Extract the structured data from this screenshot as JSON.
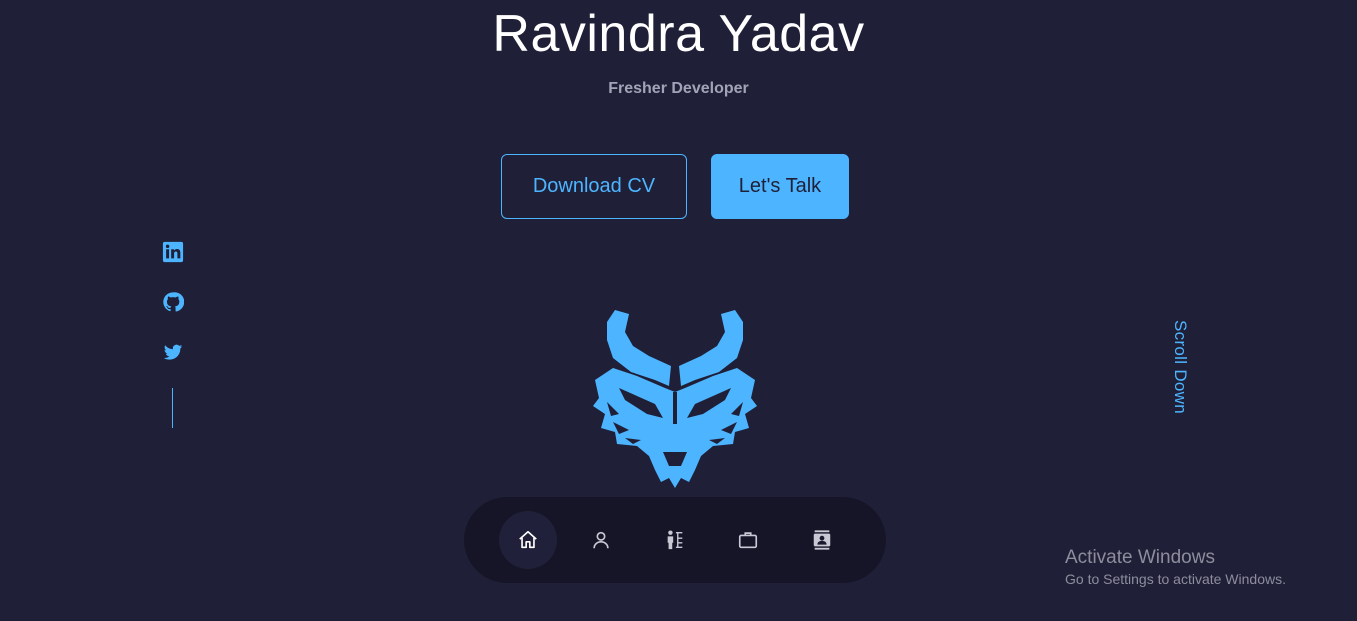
{
  "header": {
    "name": "Ravindra Yadav",
    "role": "Fresher Developer"
  },
  "cta": {
    "download_label": "Download CV",
    "talk_label": "Let's Talk"
  },
  "socials": [
    {
      "name": "linkedin-icon"
    },
    {
      "name": "github-icon"
    },
    {
      "name": "twitter-icon"
    }
  ],
  "logo": {
    "icon": "wolf-head-icon"
  },
  "scroll": {
    "label": "Scroll Down"
  },
  "nav": {
    "items": [
      {
        "icon": "home-icon",
        "active": true
      },
      {
        "icon": "user-icon",
        "active": false
      },
      {
        "icon": "skills-icon",
        "active": false
      },
      {
        "icon": "briefcase-icon",
        "active": false
      },
      {
        "icon": "contact-icon",
        "active": false
      }
    ]
  },
  "watermark": {
    "title": "Activate Windows",
    "subtitle": "Go to Settings to activate Windows."
  },
  "colors": {
    "background": "#1f1f38",
    "accent": "#4db5ff",
    "muted": "#a3a3b8"
  }
}
